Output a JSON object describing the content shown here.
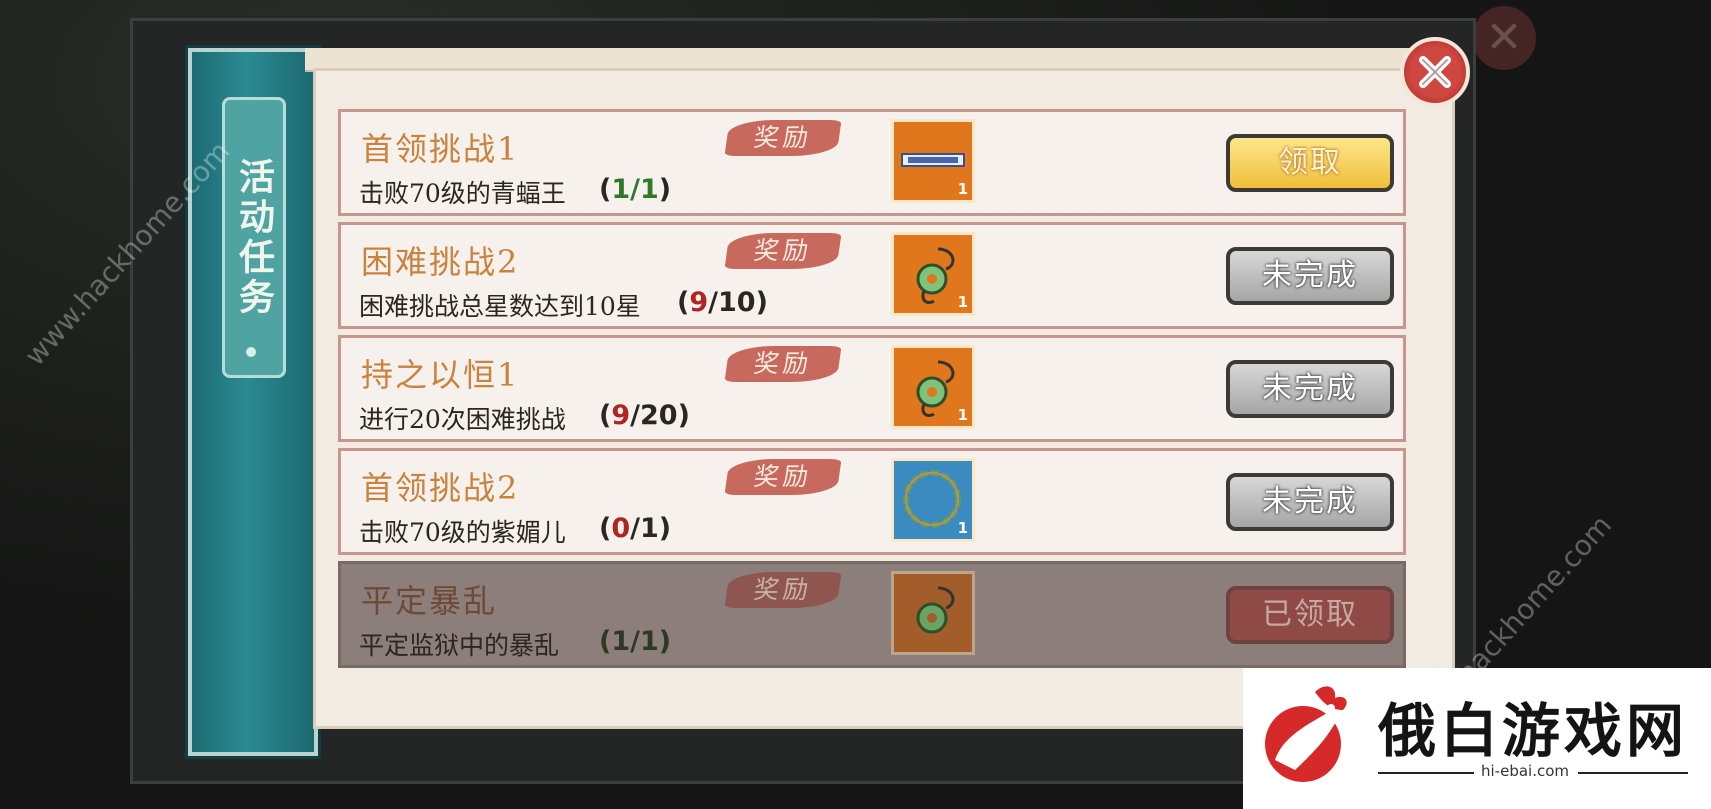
{
  "background": {
    "title_glyphs": "活动"
  },
  "side_tab": {
    "label": "活动任务"
  },
  "tasks": [
    {
      "title": "首领挑战1",
      "desc": "击败70级的青蝠王",
      "progress": "(1/1)",
      "progress_cur": "1",
      "progress_total": "/1",
      "reward_label": "奖励",
      "item_icon": "scroll-icon",
      "item_count": "1",
      "button": "领取",
      "state": "claimable"
    },
    {
      "title": "困难挑战2",
      "desc": "困难挑战总星数达到10星",
      "progress": "(9/10)",
      "progress_cur": "9",
      "progress_total": "/10",
      "reward_label": "奖励",
      "item_icon": "jade-pendant-icon",
      "item_count": "1",
      "button": "未完成",
      "state": "incomplete"
    },
    {
      "title": "持之以恒1",
      "desc": "进行20次困难挑战",
      "progress": "(9/20)",
      "progress_cur": "9",
      "progress_total": "/20",
      "reward_label": "奖励",
      "item_icon": "jade-pendant-icon",
      "item_count": "1",
      "button": "未完成",
      "state": "incomplete"
    },
    {
      "title": "首领挑战2",
      "desc": "击败70级的紫媚儿",
      "progress": "(0/1)",
      "progress_cur": "0",
      "progress_total": "/1",
      "reward_label": "奖励",
      "item_icon": "bracelet-icon",
      "item_count": "1",
      "button": "未完成",
      "state": "incomplete"
    },
    {
      "title": "平定暴乱",
      "desc": "平定监狱中的暴乱",
      "progress": "(1/1)",
      "progress_cur": "1",
      "progress_total": "/1",
      "reward_label": "奖励",
      "item_icon": "jade-pendant-icon",
      "item_count": "",
      "button": "已领取",
      "state": "claimed"
    }
  ],
  "watermarks": {
    "left": "www.hackhome.com",
    "right": "hackhome.com"
  },
  "logo": {
    "name": "俄白游戏网",
    "url": "hi-ebai.com"
  },
  "colors": {
    "accent_teal": "#2a8a92",
    "reward_red": "#c8695e",
    "done_green": "#2f7a2a",
    "progress_red": "#b02424",
    "gold_button": "#f0bf3a"
  }
}
